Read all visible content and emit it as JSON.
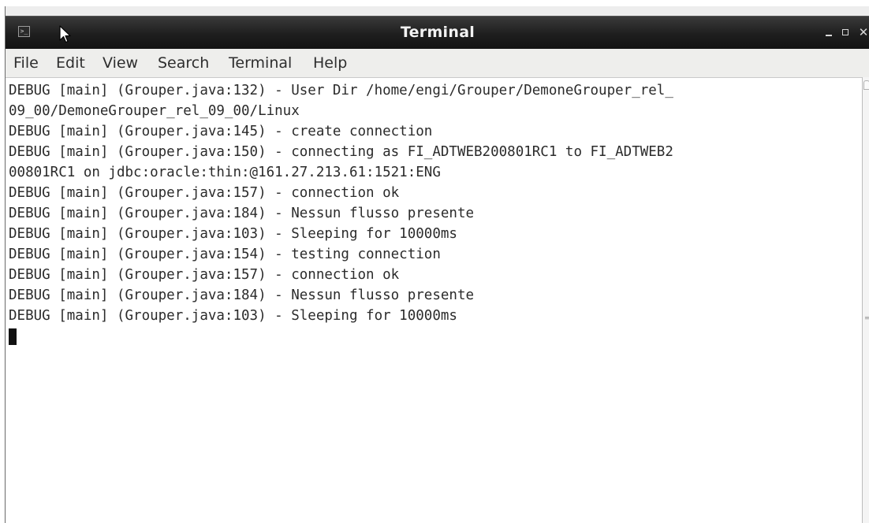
{
  "window": {
    "title": "Terminal",
    "icon": "terminal-icon",
    "controls": {
      "minimize": "minimize-icon",
      "maximize": "maximize-icon",
      "close": "✕"
    }
  },
  "menu": {
    "items": [
      "File",
      "Edit",
      "View",
      "Search",
      "Terminal",
      "Help"
    ]
  },
  "terminal": {
    "lines": [
      "DEBUG [main] (Grouper.java:132) - User Dir /home/engi/Grouper/DemoneGrouper_rel_",
      "09_00/DemoneGrouper_rel_09_00/Linux",
      "DEBUG [main] (Grouper.java:145) - create connection",
      "DEBUG [main] (Grouper.java:150) - connecting as FI_ADTWEB200801RC1 to FI_ADTWEB2",
      "00801RC1 on jdbc:oracle:thin:@161.27.213.61:1521:ENG",
      "DEBUG [main] (Grouper.java:157) - connection ok",
      "DEBUG [main] (Grouper.java:184) - Nessun flusso presente",
      "DEBUG [main] (Grouper.java:103) - Sleeping for 10000ms",
      "DEBUG [main] (Grouper.java:154) - testing connection",
      "DEBUG [main] (Grouper.java:157) - connection ok",
      "DEBUG [main] (Grouper.java:184) - Nessun flusso presente",
      "DEBUG [main] (Grouper.java:103) - Sleeping for 10000ms"
    ]
  },
  "colors": {
    "titlebar": "#1e1e1e",
    "menubar": "#eeeeec",
    "terminal_bg": "#ffffff",
    "terminal_fg": "#2b2b2b"
  }
}
